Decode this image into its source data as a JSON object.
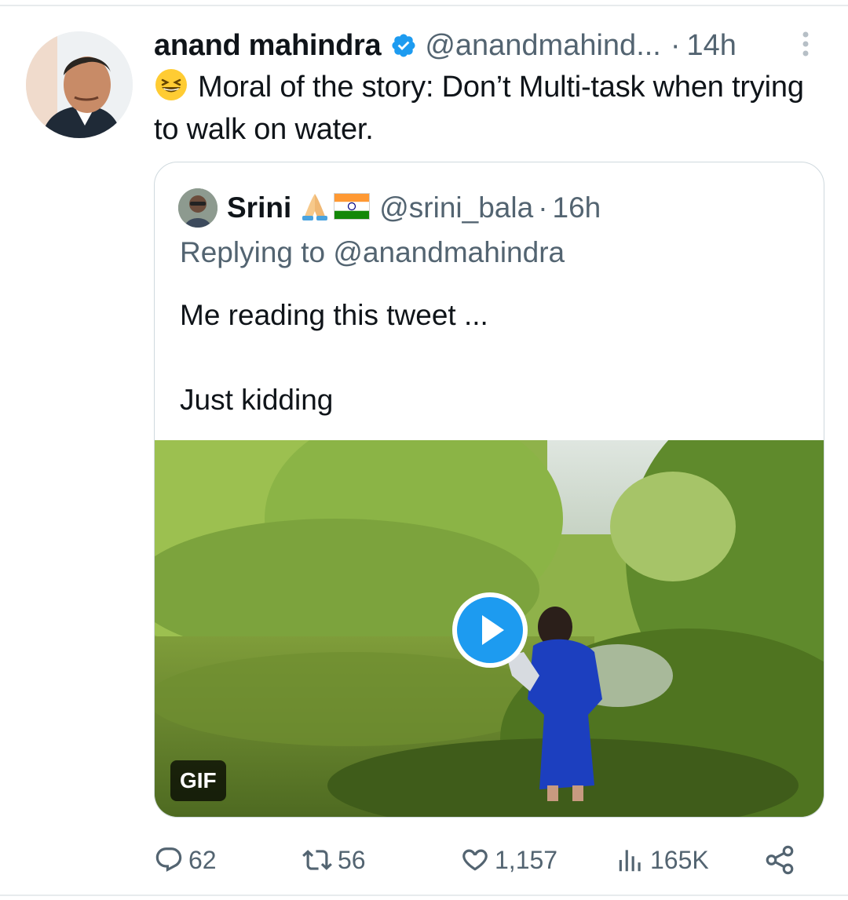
{
  "tweet": {
    "author_name": "anand mahindra",
    "author_handle": "@anandmahind...",
    "time": "14h",
    "separator": "·",
    "text": "Moral of the story: Don’t Multi-task when trying to walk on water.",
    "emoji": "grinning-squinting-face"
  },
  "quoted": {
    "author_name": "Srini",
    "author_emojis": [
      "folded-hands",
      "india-flag"
    ],
    "author_handle": "@srini_bala",
    "separator": "·",
    "time": "16h",
    "replying_to": "Replying to @anandmahindra",
    "text_line1": "Me reading this tweet ...",
    "text_line2": "Just kidding",
    "media_badge": "GIF"
  },
  "actions": {
    "replies": "62",
    "retweets": "56",
    "likes": "1,157",
    "views": "165K"
  },
  "colors": {
    "text": "#0f1419",
    "secondary": "#536471",
    "verified": "#1d9bf0",
    "border": "#cfd9de"
  }
}
